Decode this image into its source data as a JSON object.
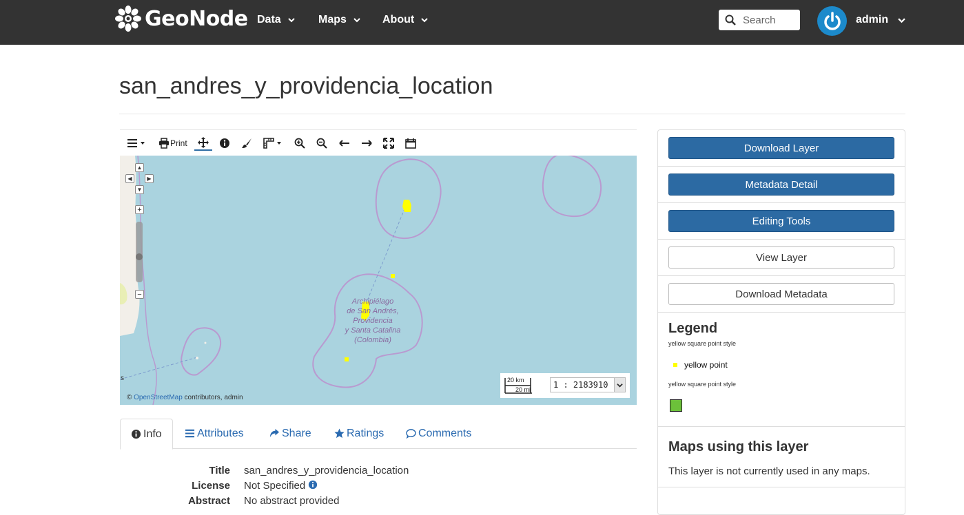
{
  "navbar": {
    "brand": "GeoNode",
    "menu": [
      {
        "label": "Data"
      },
      {
        "label": "Maps"
      },
      {
        "label": "About"
      }
    ],
    "search_placeholder": "Search",
    "user": "admin"
  },
  "page": {
    "title": "san_andres_y_providencia_location"
  },
  "map": {
    "toolbar": {
      "print_label": "Print"
    },
    "attribution_prefix": "©",
    "attribution_link": "OpenStreetMap",
    "attribution_suffix": "contributors, admin",
    "scale_km": "20 km",
    "scale_mi": "20 mi",
    "scale_ratio": "1 : 2183910",
    "region_label": [
      "Archipiélago",
      "de San Andrés,",
      "Providencia",
      "y Santa Catalina",
      "(Colombia)"
    ],
    "edge_label": "s",
    "colors": {
      "water": "#aad3df",
      "boundary": "#b99ad0",
      "feature": "#ffff00"
    }
  },
  "tabs": [
    {
      "label": "Info",
      "icon": "info-circle-icon"
    },
    {
      "label": "Attributes",
      "icon": "list-icon"
    },
    {
      "label": "Share",
      "icon": "share-icon"
    },
    {
      "label": "Ratings",
      "icon": "star-icon"
    },
    {
      "label": "Comments",
      "icon": "comment-icon"
    }
  ],
  "info": [
    {
      "key": "Title",
      "value": "san_andres_y_providencia_location"
    },
    {
      "key": "License",
      "value": "Not Specified"
    },
    {
      "key": "Abstract",
      "value": "No abstract provided"
    }
  ],
  "sidebar": {
    "buttons": {
      "download_layer": "Download Layer",
      "metadata_detail": "Metadata Detail",
      "editing_tools": "Editing Tools",
      "view_layer": "View Layer",
      "download_metadata": "Download Metadata"
    },
    "legend": {
      "title": "Legend",
      "caption_1": "yellow square point style",
      "item_1": "yellow point",
      "caption_2": "yellow square point style"
    },
    "maps_using": {
      "title": "Maps using this layer",
      "text": "This layer is not currently used in any maps."
    }
  },
  "colors": {
    "navbar_bg": "#333333",
    "primary_button": "#2c6aa3",
    "avatar": "#1c8acb",
    "link": "#2a6ab0"
  }
}
